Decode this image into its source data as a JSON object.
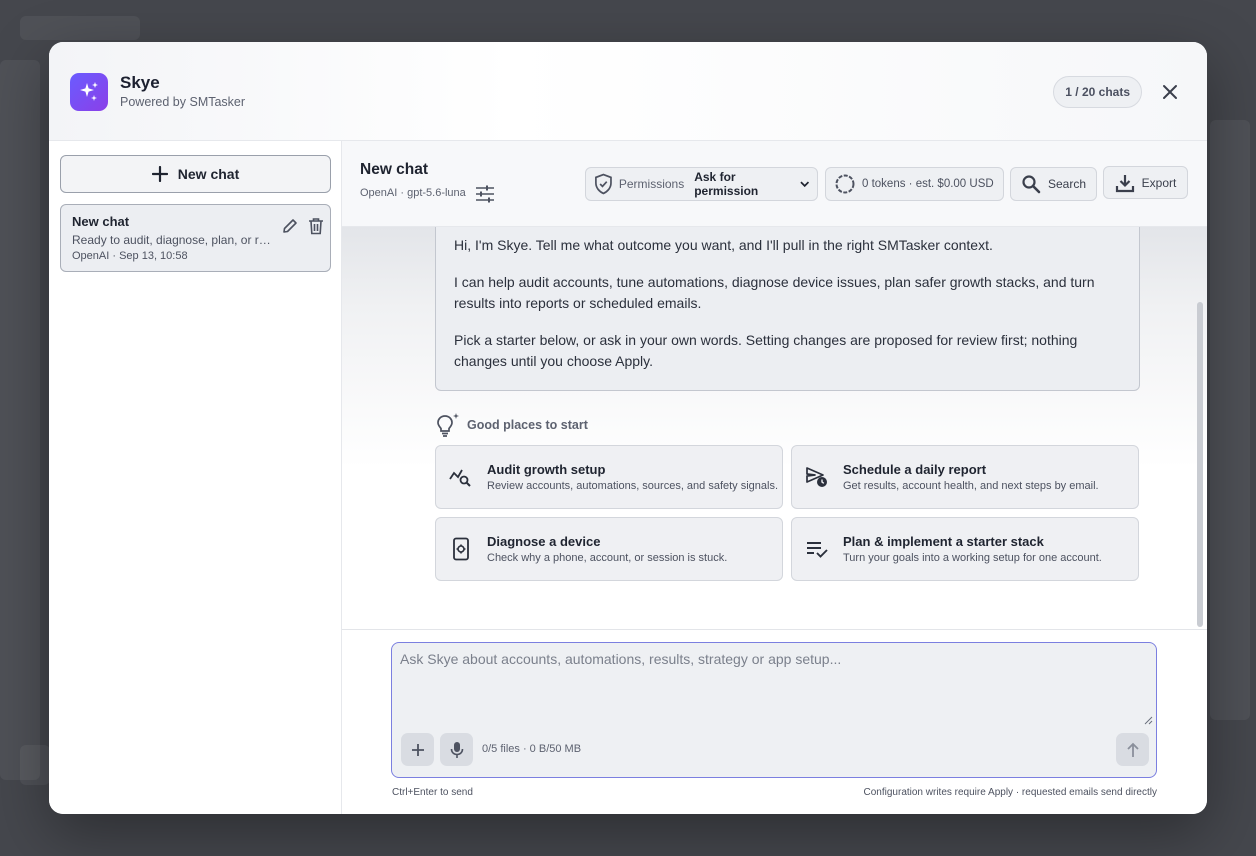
{
  "app": {
    "name": "Skye",
    "subtitle": "Powered by SMTasker",
    "chat_count": "1 / 20 chats"
  },
  "sidebar": {
    "new_chat_label": "New chat",
    "chats": [
      {
        "title": "New chat",
        "preview": "Ready to audit, diagnose, plan, or report.",
        "meta": "OpenAI · Sep 13, 10:58"
      }
    ]
  },
  "toolbar": {
    "title": "New chat",
    "model": "OpenAI · gpt-5.6-luna",
    "permissions_label": "Permissions",
    "permissions_value": "Ask for permission",
    "tokens": "0 tokens · est. $0.00 USD",
    "search_label": "Search",
    "export_label": "Export"
  },
  "welcome": {
    "p1": "Hi, I'm Skye. Tell me what outcome you want, and I'll pull in the right SMTasker context.",
    "p2": "I can help audit accounts, tune automations, diagnose device issues, plan safer growth stacks, and turn results into reports or scheduled emails.",
    "p3": "Pick a starter below, or ask in your own words. Setting changes are proposed for review first; nothing changes until you choose Apply."
  },
  "starters": {
    "heading": "Good places to start",
    "cards": [
      {
        "title": "Audit growth setup",
        "desc": "Review accounts, automations, sources, and safety signals.",
        "icon": "chart-search-icon"
      },
      {
        "title": "Schedule a daily report",
        "desc": "Get results, account health, and next steps by email.",
        "icon": "scheduled-send-icon"
      },
      {
        "title": "Diagnose a device",
        "desc": "Check why a phone, account, or session is stuck.",
        "icon": "device-settings-icon"
      },
      {
        "title": "Plan & implement a starter stack",
        "desc": "Turn your goals into a working setup for one account.",
        "icon": "checklist-icon"
      }
    ]
  },
  "composer": {
    "placeholder": "Ask Skye about accounts, automations, results, strategy or app setup...",
    "file_info": "0/5 files · 0 B/50 MB",
    "hint_left": "Ctrl+Enter to send",
    "hint_right": "Configuration writes require Apply · requested emails send directly"
  },
  "colors": {
    "accent": "#6a5cff",
    "accent_border": "#7b7fe0"
  }
}
